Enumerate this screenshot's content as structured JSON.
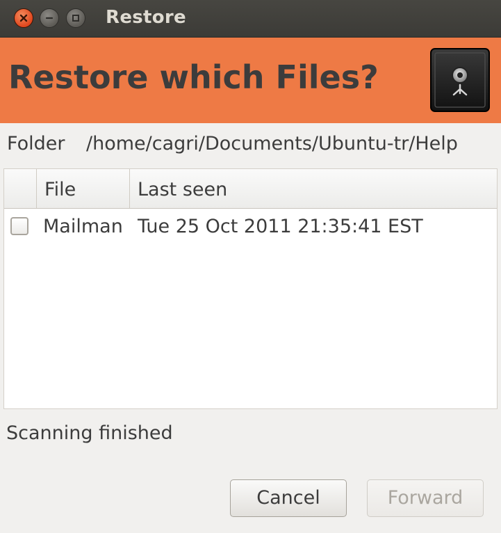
{
  "window": {
    "title": "Restore",
    "controls": [
      "close-icon",
      "minimize-icon",
      "maximize-icon"
    ]
  },
  "banner": {
    "heading": "Restore which Files?",
    "icon": "safe-icon",
    "color": "#ee7a45"
  },
  "folder": {
    "label": "Folder",
    "path": "/home/cagri/Documents/Ubuntu-tr/Help"
  },
  "table": {
    "columns": [
      "",
      "File",
      "Last seen"
    ],
    "rows": [
      {
        "checked": false,
        "file": "Mailman",
        "last_seen": "Tue 25 Oct 2011 21:35:41 EST"
      }
    ]
  },
  "status": "Scanning finished",
  "buttons": {
    "cancel": "Cancel",
    "forward": "Forward"
  }
}
